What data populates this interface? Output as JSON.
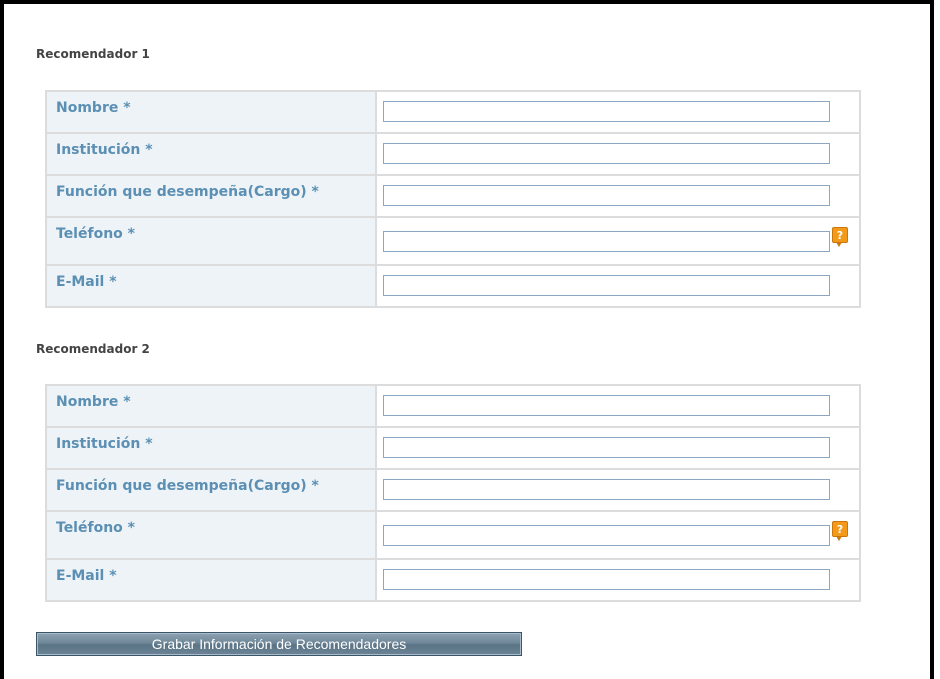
{
  "sections": [
    {
      "title": "Recomendador 1",
      "fields": [
        {
          "label": "Nombre *",
          "value": ""
        },
        {
          "label": "Institución *",
          "value": ""
        },
        {
          "label": "Función que desempeña(Cargo) *",
          "value": ""
        },
        {
          "label": "Teléfono *",
          "value": "",
          "help_icon": "question-help-icon"
        },
        {
          "label": "E-Mail *",
          "value": ""
        }
      ]
    },
    {
      "title": "Recomendador 2",
      "fields": [
        {
          "label": "Nombre *",
          "value": ""
        },
        {
          "label": "Institución *",
          "value": ""
        },
        {
          "label": "Función que desempeña(Cargo) *",
          "value": ""
        },
        {
          "label": "Teléfono *",
          "value": "",
          "help_icon": "question-help-icon"
        },
        {
          "label": "E-Mail *",
          "value": ""
        }
      ]
    }
  ],
  "help_icon_glyph": "?",
  "save_button_label": "Grabar Información de Recomendadores",
  "colors": {
    "label_text": "#5b8fb3",
    "label_bg": "#edf3f7",
    "help_icon": "#f39a1b",
    "button": "#6f8798"
  }
}
